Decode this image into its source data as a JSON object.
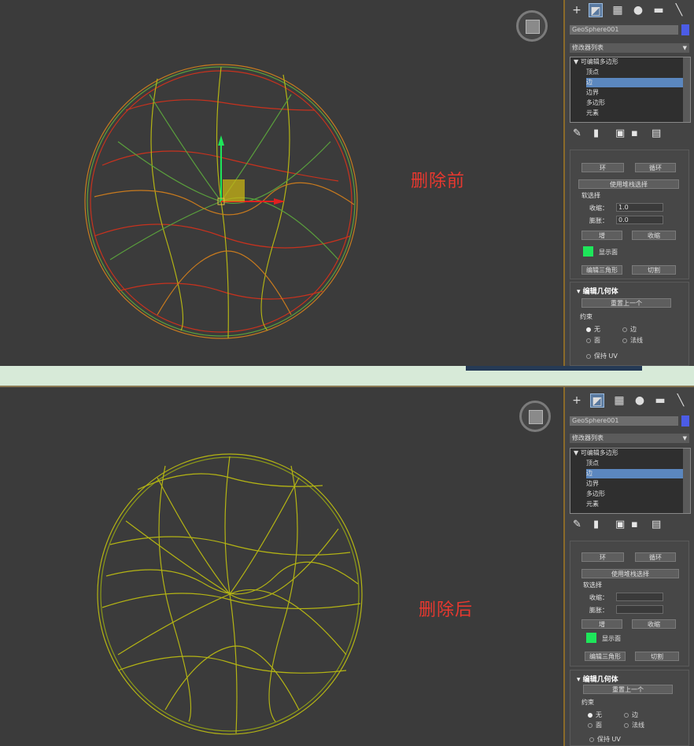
{
  "top": {
    "label": "删除前",
    "command_panel": {
      "object_name": "GeoSphere001",
      "modifier_list": "修改器列表",
      "stack": {
        "root": "可编辑多边形",
        "items": [
          "顶点",
          "边",
          "边界",
          "多边形",
          "元素"
        ],
        "selected_index": 1
      },
      "buttons": {
        "ring": "环",
        "loop": "循环",
        "use_stack": "使用堆栈选择",
        "grow": "增",
        "shrink": "收缩",
        "edit_tris": "编辑三角形",
        "cut": "切割",
        "reset": "重置上一个"
      },
      "fields": {
        "soft_sel": "软选择",
        "pinch": "收缩：",
        "pinch_value": "1.0",
        "bubble": "膨胀：",
        "bubble_value": "0.0",
        "shade_face": "显示面",
        "edit_geometry": "编辑几何体",
        "constraints": "约束",
        "none": "无",
        "edge": "边",
        "face": "面",
        "normal": "法线",
        "preserve_uv": "保持 UV"
      }
    }
  },
  "bottom": {
    "label": "删除后",
    "command_panel": {
      "object_name": "GeoSphere001",
      "modifier_list": "修改器列表",
      "stack": {
        "root": "可编辑多边形",
        "items": [
          "顶点",
          "边",
          "边界",
          "多边形",
          "元素"
        ],
        "selected_index": 1
      },
      "buttons": {
        "ring": "环",
        "loop": "循环",
        "use_stack": "使用堆栈选择",
        "grow": "增",
        "shrink": "收缩",
        "edit_tris": "编辑三角形",
        "cut": "切割",
        "reset": "重置上一个"
      },
      "fields": {
        "soft_sel": "软选择",
        "pinch": "收缩：",
        "pinch_value": "",
        "bubble": "膨胀：",
        "bubble_value": "",
        "shade_face": "显示面",
        "edit_geometry": "编辑几何体",
        "constraints": "约束",
        "none": "无",
        "edge": "边",
        "face": "面",
        "normal": "法线",
        "preserve_uv": "保持 UV"
      }
    }
  },
  "colors": {
    "accent_blue": "#5b87bf",
    "label_red": "#e8382f",
    "wire_red": "#c8321e",
    "wire_orange": "#c87a1e",
    "wire_yellow": "#b4b414",
    "wire_green": "#5aa03c",
    "shade_green": "#1ee65a"
  }
}
